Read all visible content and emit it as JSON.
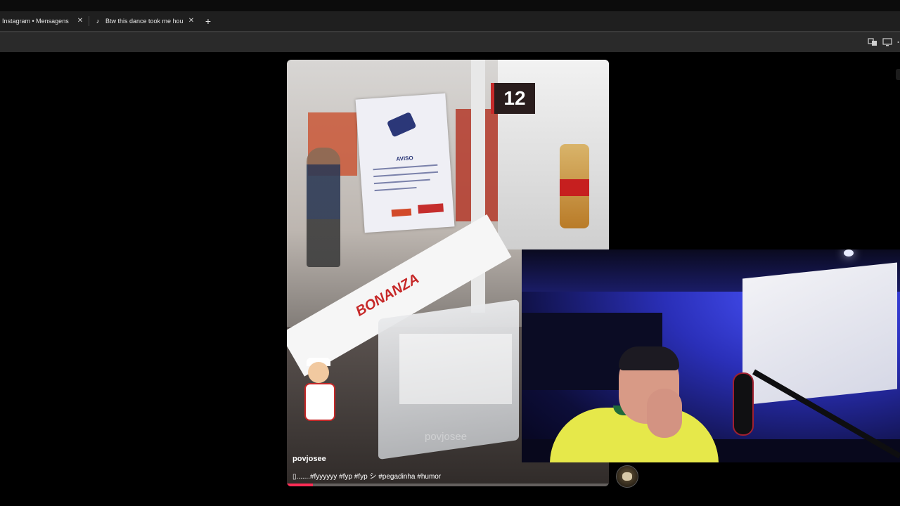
{
  "browser": {
    "tabs": [
      {
        "label": "Instagram • Mensagens"
      },
      {
        "label": "Btw this dance took me hours t"
      }
    ],
    "close_glyph": "✕",
    "new_tab_glyph": "+",
    "toolbar_icons": [
      "translate-icon",
      "cast-icon",
      "more-icon"
    ]
  },
  "video": {
    "username": "povjosee",
    "caption": "▯.......#fyyyyyy #fyp #fyp シ #pegadinha #humor",
    "watermark": "povjosee",
    "sign_number": "12",
    "aviso_title": "AVISO",
    "store_brand": "BONANZA",
    "progress": 0.08,
    "progress_color": "#fe2c55"
  },
  "colors": {
    "tab_bar": "#1f1f1f",
    "toolbar": "#2a2a2a",
    "background": "#000000"
  }
}
